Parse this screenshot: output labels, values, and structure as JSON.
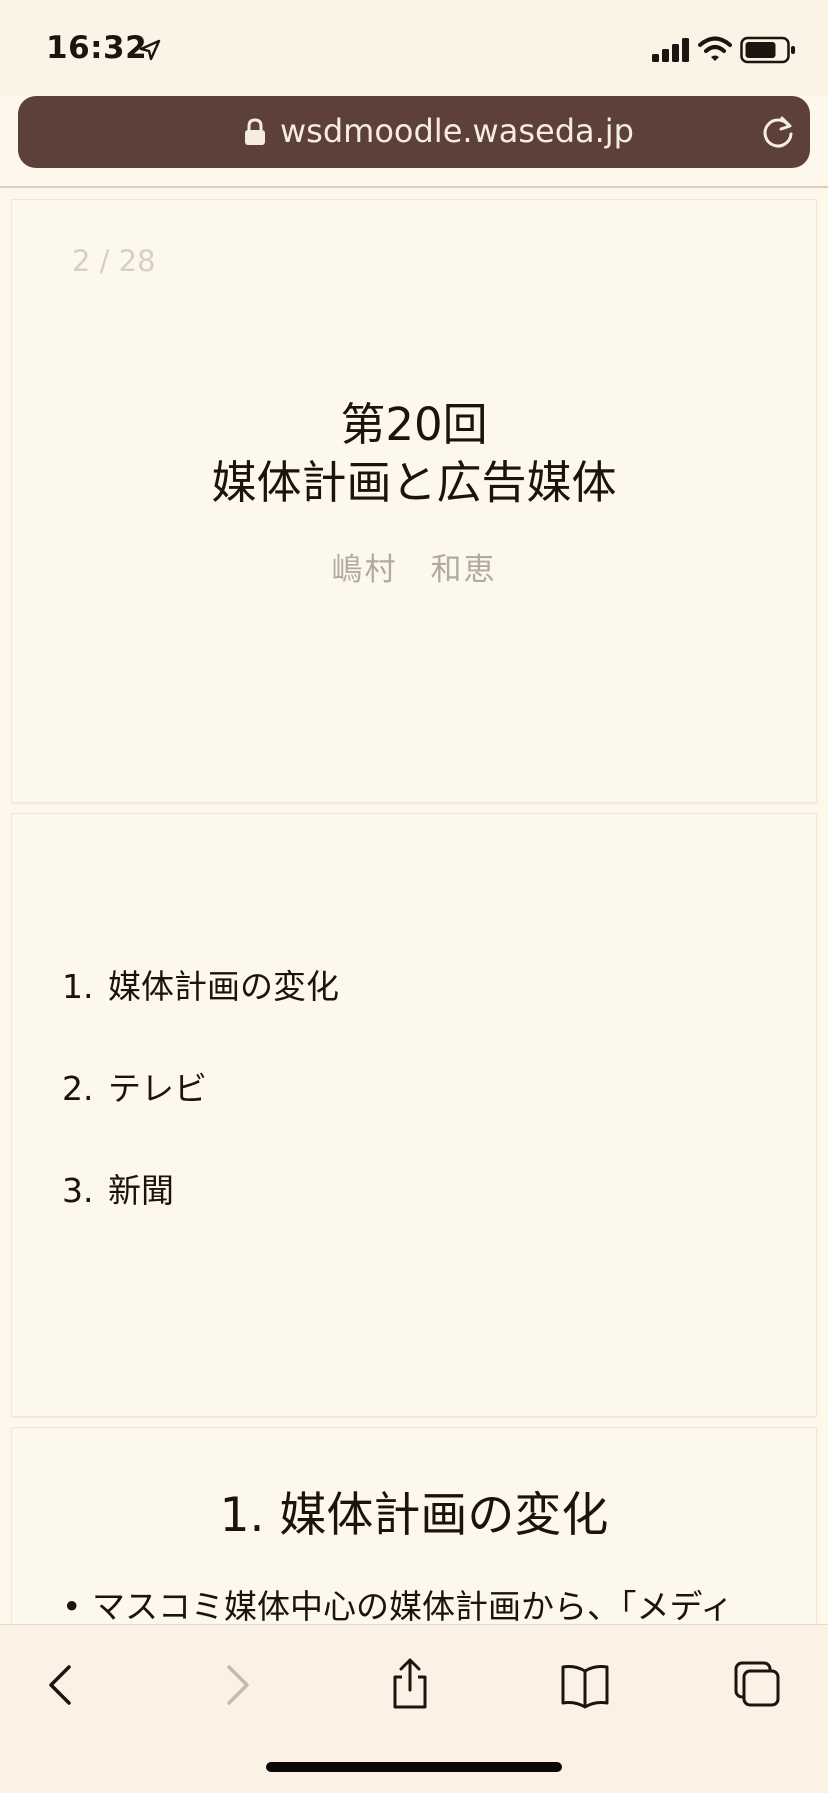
{
  "status_bar": {
    "time": "16:32"
  },
  "browser": {
    "url": "wsdmoodle.waseda.jp"
  },
  "slide1": {
    "page_counter": "2 / 28",
    "title_line1": "第20回",
    "title_line2": "媒体計画と広告媒体",
    "author": "嶋村　和恵"
  },
  "slide2": {
    "agenda": [
      {
        "number": "1.",
        "label": "媒体計画の変化"
      },
      {
        "number": "2.",
        "label": "テレビ"
      },
      {
        "number": "3.",
        "label": "新聞"
      }
    ]
  },
  "slide3": {
    "heading": "1. 媒体計画の変化",
    "bullet": "•",
    "bullet_text": "マスコミ媒体中心の媒体計画から、「メディ"
  },
  "colors": {
    "url_bar_bg": "#5d4037",
    "page_bg": "#fdf7ec",
    "text_dark": "#1e120c",
    "text_muted": "#b1aaa1",
    "counter_text": "#d6cfc4"
  },
  "icons": {
    "status": [
      "location-icon",
      "signal-icon",
      "wifi-icon",
      "battery-icon"
    ],
    "toolbar": [
      "back-icon",
      "forward-icon",
      "share-icon",
      "bookmarks-icon",
      "tabs-icon"
    ]
  }
}
